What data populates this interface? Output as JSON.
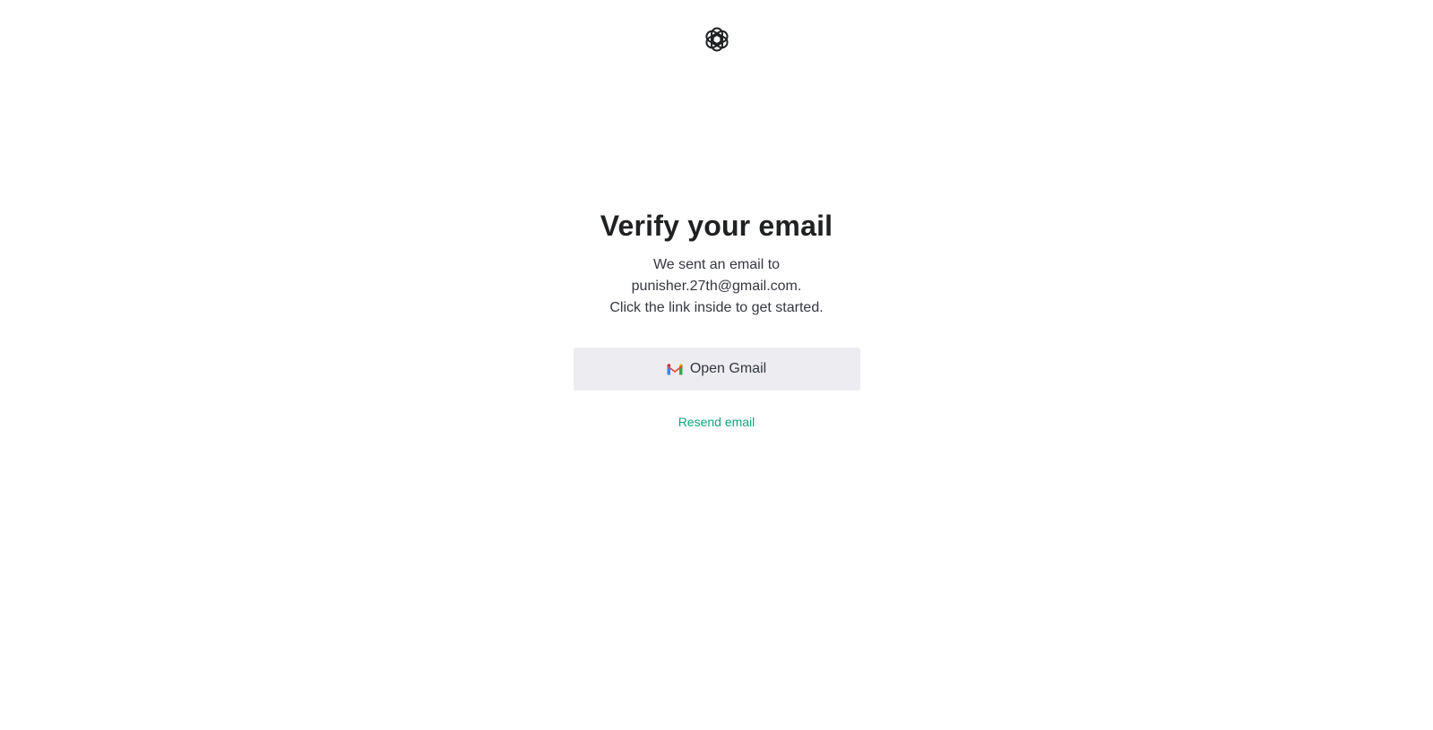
{
  "header": {
    "logo_icon": "openai-logo-icon"
  },
  "verify": {
    "title": "Verify your email",
    "message_line1": "We sent an email to",
    "email": "punisher.27th@gmail.com.",
    "message_line3": "Click the link inside to get started.",
    "open_gmail_label": "Open Gmail",
    "open_gmail_icon": "gmail-icon",
    "resend_label": "Resend email"
  },
  "colors": {
    "accent": "#10a37f",
    "button_bg": "#ececf1",
    "title": "#202123",
    "text": "#353740"
  }
}
